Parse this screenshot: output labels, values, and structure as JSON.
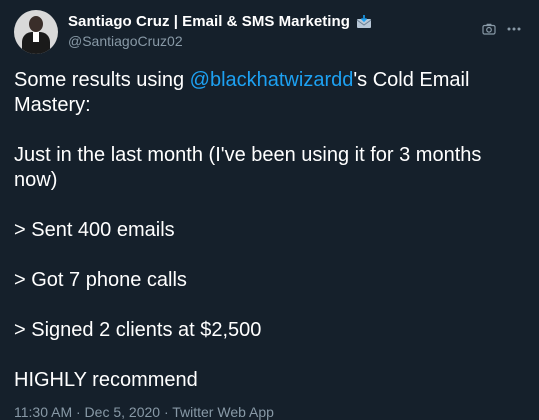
{
  "author": {
    "display_name": "Santiago Cruz | Email & SMS Marketing",
    "handle": "@SantiagoCruz02",
    "badge_icon": "envelope-download-icon"
  },
  "icons": {
    "camera": "camera-icon",
    "more": "more-icon"
  },
  "tweet": {
    "line1_prefix": "Some results using ",
    "mention": "@blackhatwizardd",
    "line1_suffix": "'s Cold Email Mastery:",
    "para2": "Just in the last month (I've been using it for 3 months now)",
    "para3": "> Sent 400 emails",
    "para4": "> Got 7 phone calls",
    "para5": "> Signed 2 clients at $2,500",
    "para6": "HIGHLY recommend"
  },
  "footer": {
    "meta": "11:30 AM · Dec 5, 2020 · Twitter Web App"
  },
  "colors": {
    "background": "#15202b",
    "text": "#ffffff",
    "secondary": "#8899a6",
    "link": "#1da1f2"
  }
}
